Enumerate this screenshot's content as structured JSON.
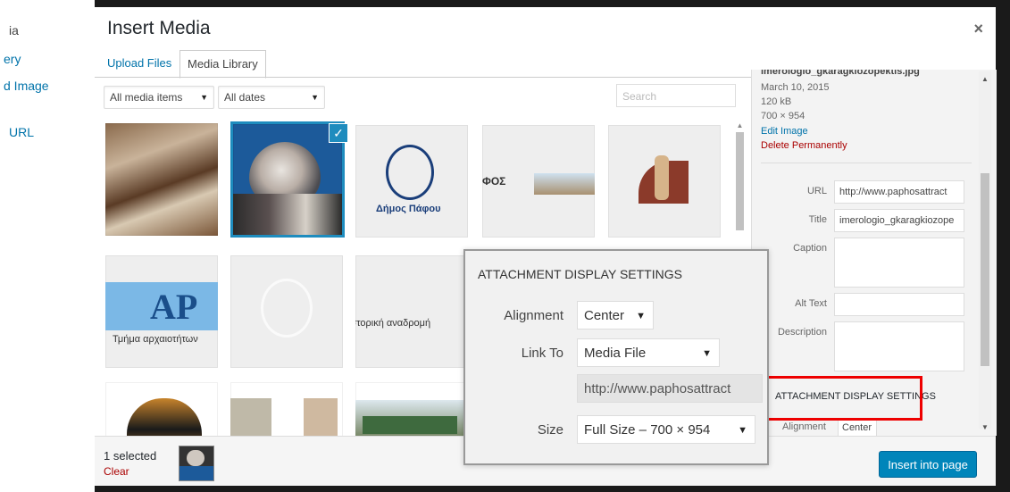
{
  "background_menu": {
    "items": [
      "ia",
      "ery",
      "d Image",
      "URL"
    ]
  },
  "modal": {
    "title": "Insert Media",
    "close_icon": "×",
    "tabs": [
      {
        "label": "Upload Files",
        "active": false
      },
      {
        "label": "Media Library",
        "active": true
      }
    ]
  },
  "toolbar": {
    "type_filter": "All media items",
    "date_filter": "All dates",
    "search_placeholder": "Search"
  },
  "grid": {
    "thumbnails": [
      {
        "caption": ""
      },
      {
        "caption": "",
        "selected": true
      },
      {
        "caption": "Δήμος Πάφου"
      },
      {
        "caption": "ΦΟΣ"
      },
      {
        "caption": ""
      },
      {
        "caption": "Τμήμα αρχαιοτήτων"
      },
      {
        "caption": ""
      },
      {
        "caption": "ιστορική αναδρομή"
      }
    ]
  },
  "attachment_details": {
    "filename": "imerologio_gkaragkiozopektis.jpg",
    "date": "March 10, 2015",
    "size": "120 kB",
    "dimensions": "700 × 954",
    "edit_link": "Edit Image",
    "delete_link": "Delete Permanently",
    "fields": {
      "url_label": "URL",
      "url_value": "http://www.paphosattract",
      "title_label": "Title",
      "title_value": "imerologio_gkaragkiozope",
      "caption_label": "Caption",
      "alt_label": "Alt Text",
      "description_label": "Description"
    },
    "settings_heading": "ATTACHMENT DISPLAY SETTINGS",
    "alignment_label": "Alignment",
    "alignment_value": "Center"
  },
  "popup": {
    "title": "ATTACHMENT DISPLAY SETTINGS",
    "alignment_label": "Alignment",
    "alignment_value": "Center",
    "link_label": "Link To",
    "link_value": "Media File",
    "link_url": "http://www.paphosattract",
    "size_label": "Size",
    "size_value": "Full Size – 700 × 954"
  },
  "footer": {
    "selected_count": "1 selected",
    "clear_label": "Clear",
    "insert_button": "Insert into page"
  },
  "colors": {
    "link": "#0073aa",
    "delete": "#a00000",
    "primary_button": "#0085ba",
    "selected_border": "#1e8cbe",
    "highlight": "#ee0000"
  }
}
